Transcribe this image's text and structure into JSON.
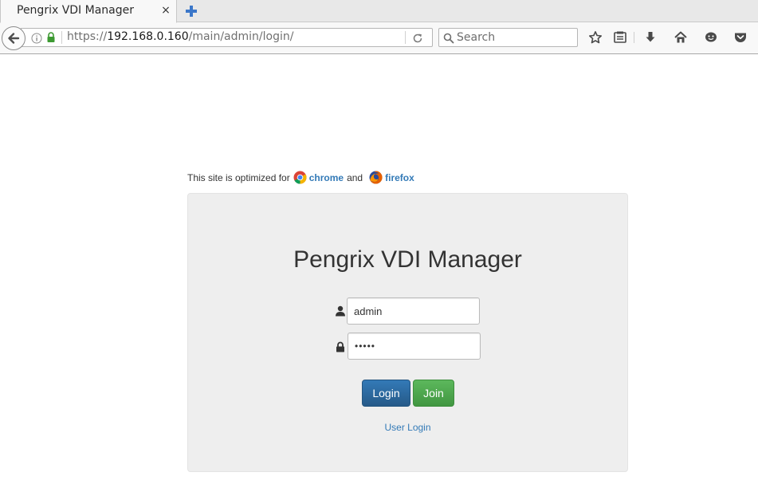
{
  "browser": {
    "tab": {
      "title": "Pengrix VDI Manager",
      "close_glyph": "×"
    },
    "url": {
      "scheme": "https://",
      "host": "192.168.0.160",
      "path": "/main/admin/login/"
    },
    "search": {
      "placeholder": "Search"
    },
    "toolbar_icons": [
      "star-icon",
      "reader-icon",
      "download-icon",
      "home-icon",
      "hello-icon",
      "pocket-icon"
    ]
  },
  "page": {
    "notice": {
      "prefix": "This site is optimized for",
      "browser1": "chrome",
      "conjunction": "and",
      "browser2": "firefox"
    },
    "login": {
      "title": "Pengrix VDI Manager",
      "username_value": "admin",
      "password_value": "•••••",
      "login_label": "Login",
      "join_label": "Join",
      "user_login_link": "User Login"
    }
  },
  "colors": {
    "link": "#337ab7",
    "login_button": "#337ab7",
    "join_button": "#5cb85c",
    "panel_bg": "#eeeeee"
  }
}
